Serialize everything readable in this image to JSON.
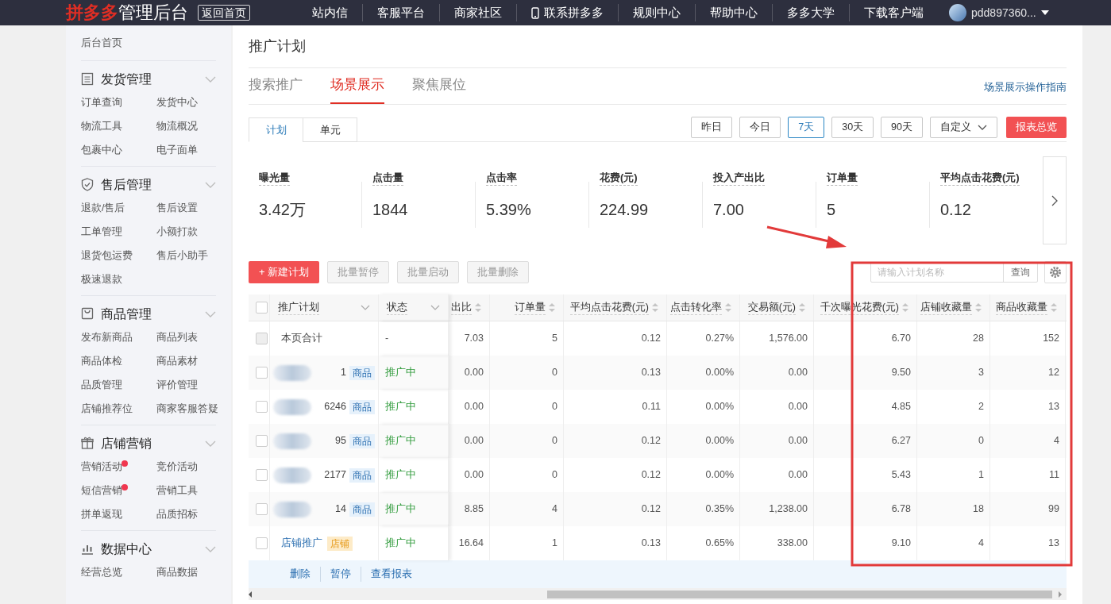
{
  "topbar": {
    "brand": "拼多多",
    "brand_suffix": "管理后台",
    "home_button": "返回首页",
    "user": "pdd897360...",
    "nav": [
      {
        "label": "站内信",
        "kind": "text"
      },
      {
        "label": "客服平台",
        "kind": "text"
      },
      {
        "label": "商家社区",
        "kind": "text"
      },
      {
        "label": "联系拼多多",
        "kind": "phone"
      },
      {
        "label": "规则中心",
        "kind": "text"
      },
      {
        "label": "帮助中心",
        "kind": "text"
      },
      {
        "label": "多多大学",
        "kind": "text"
      },
      {
        "label": "下载客户端",
        "kind": "text"
      }
    ]
  },
  "sidebar": {
    "home": "后台首页",
    "sections": [
      {
        "title": "发货管理",
        "kind": "document",
        "items": [
          {
            "label": "订单查询",
            "dot": false
          },
          {
            "label": "发货中心",
            "dot": false
          },
          {
            "label": "物流工具",
            "dot": false
          },
          {
            "label": "物流概况",
            "dot": false
          },
          {
            "label": "包裹中心",
            "dot": false
          },
          {
            "label": "电子面单",
            "dot": false
          }
        ]
      },
      {
        "title": "售后管理",
        "kind": "shield",
        "items": [
          {
            "label": "退款/售后",
            "dot": false
          },
          {
            "label": "售后设置",
            "dot": false
          },
          {
            "label": "工单管理",
            "dot": false
          },
          {
            "label": "小额打款",
            "dot": false
          },
          {
            "label": "退货包运费",
            "dot": false
          },
          {
            "label": "售后小助手",
            "dot": false
          },
          {
            "label": "极速退款",
            "dot": false
          }
        ]
      },
      {
        "title": "商品管理",
        "kind": "bag",
        "items": [
          {
            "label": "发布新商品",
            "dot": false
          },
          {
            "label": "商品列表",
            "dot": false
          },
          {
            "label": "商品体检",
            "dot": false
          },
          {
            "label": "商品素材",
            "dot": false
          },
          {
            "label": "品质管理",
            "dot": false
          },
          {
            "label": "评价管理",
            "dot": false
          },
          {
            "label": "店铺推荐位",
            "dot": false
          },
          {
            "label": "商家客服答疑",
            "dot": false
          }
        ]
      },
      {
        "title": "店铺营销",
        "kind": "gift",
        "items": [
          {
            "label": "营销活动",
            "dot": true
          },
          {
            "label": "竞价活动",
            "dot": false
          },
          {
            "label": "短信营销",
            "dot": true
          },
          {
            "label": "营销工具",
            "dot": false
          },
          {
            "label": "拼单返现",
            "dot": false
          },
          {
            "label": "品质招标",
            "dot": false
          }
        ]
      },
      {
        "title": "数据中心",
        "kind": "chart",
        "items": [
          {
            "label": "经营总览",
            "dot": false
          },
          {
            "label": "商品数据",
            "dot": false
          }
        ]
      }
    ]
  },
  "page_title": "推广计划",
  "channel_tabs": [
    {
      "label": "搜索推广",
      "selected": false
    },
    {
      "label": "场景展示",
      "selected": true
    },
    {
      "label": "聚焦展位",
      "selected": false
    }
  ],
  "guide_link": "场景展示操作指南",
  "view_tabs": [
    {
      "label": "计划",
      "selected": true
    },
    {
      "label": "单元",
      "selected": false
    }
  ],
  "date_ranges": [
    {
      "label": "昨日",
      "selected": false,
      "kind": "plain"
    },
    {
      "label": "今日",
      "selected": false,
      "kind": "plain"
    },
    {
      "label": "7天",
      "selected": true,
      "kind": "plain"
    },
    {
      "label": "30天",
      "selected": false,
      "kind": "plain"
    },
    {
      "label": "90天",
      "selected": false,
      "kind": "plain"
    },
    {
      "label": "自定义",
      "selected": false,
      "kind": "dropdown"
    }
  ],
  "report_button": "报表总览",
  "metrics": [
    {
      "label": "曝光量",
      "value": "3.42万"
    },
    {
      "label": "点击量",
      "value": "1844"
    },
    {
      "label": "点击率",
      "value": "5.39%"
    },
    {
      "label": "花费(元)",
      "value": "224.99"
    },
    {
      "label": "投入产出比",
      "value": "7.00"
    },
    {
      "label": "订单量",
      "value": "5"
    },
    {
      "label": "平均点击花费(元)",
      "value": "0.12"
    }
  ],
  "toolbar": {
    "new_button": "+ 新建计划",
    "batch_buttons": [
      "批量暂停",
      "批量启动",
      "批量删除"
    ],
    "search": {
      "placeholder": "请输入计划名称"
    },
    "query_button": "查询"
  },
  "table": {
    "select_all_checked": false,
    "columns": [
      {
        "label": "推广计划",
        "kind": "filter"
      },
      {
        "label": "状态",
        "kind": "filter"
      },
      {
        "label": "出比",
        "kind": "sort"
      },
      {
        "label": "订单量",
        "kind": "sort"
      },
      {
        "label": "平均点击花费(元)",
        "kind": "sort"
      },
      {
        "label": "点击转化率",
        "kind": "sort"
      },
      {
        "label": "交易额(元)",
        "kind": "sort"
      },
      {
        "label": "千次曝光花费(元)",
        "kind": "sort"
      },
      {
        "label": "店铺收藏量",
        "kind": "sort"
      },
      {
        "label": "商品收藏量",
        "kind": "sort"
      }
    ],
    "rows": [
      {
        "kind": "summary",
        "checked": false,
        "plan": "本页合计",
        "status": "-",
        "cells": [
          "7.03",
          "5",
          "0.12",
          "0.27%",
          "1,576.00",
          "6.70",
          "28",
          "152"
        ]
      },
      {
        "kind": "goods",
        "checked": false,
        "redacted": true,
        "plan": "1",
        "tag": "商品",
        "status": "推广中",
        "cells": [
          "0.00",
          "0",
          "0.13",
          "0.00%",
          "0.00",
          "9.50",
          "3",
          "12"
        ]
      },
      {
        "kind": "goods",
        "checked": false,
        "redacted": true,
        "plan": "6246",
        "tag": "商品",
        "status": "推广中",
        "cells": [
          "0.00",
          "0",
          "0.11",
          "0.00%",
          "0.00",
          "4.85",
          "2",
          "13"
        ]
      },
      {
        "kind": "goods",
        "checked": false,
        "redacted": true,
        "plan": "95",
        "tag": "商品",
        "status": "推广中",
        "cells": [
          "0.00",
          "0",
          "0.12",
          "0.00%",
          "0.00",
          "6.27",
          "0",
          "4"
        ]
      },
      {
        "kind": "goods",
        "checked": false,
        "redacted": true,
        "plan": "2177",
        "tag": "商品",
        "status": "推广中",
        "cells": [
          "0.00",
          "0",
          "0.12",
          "0.00%",
          "0.00",
          "5.43",
          "1",
          "11"
        ]
      },
      {
        "kind": "goods",
        "checked": false,
        "redacted": true,
        "plan": "14",
        "tag": "商品",
        "status": "推广中",
        "cells": [
          "8.85",
          "4",
          "0.12",
          "0.35%",
          "1,238.00",
          "6.78",
          "18",
          "99"
        ]
      },
      {
        "kind": "shop",
        "checked": false,
        "redacted": false,
        "plan": "店铺推广",
        "tag": "店铺",
        "status": "推广中",
        "cells": [
          "16.64",
          "1",
          "0.13",
          "0.65%",
          "338.00",
          "9.10",
          "4",
          "13"
        ]
      }
    ],
    "footer_actions": [
      "删除",
      "暂停",
      "查看报表"
    ]
  }
}
